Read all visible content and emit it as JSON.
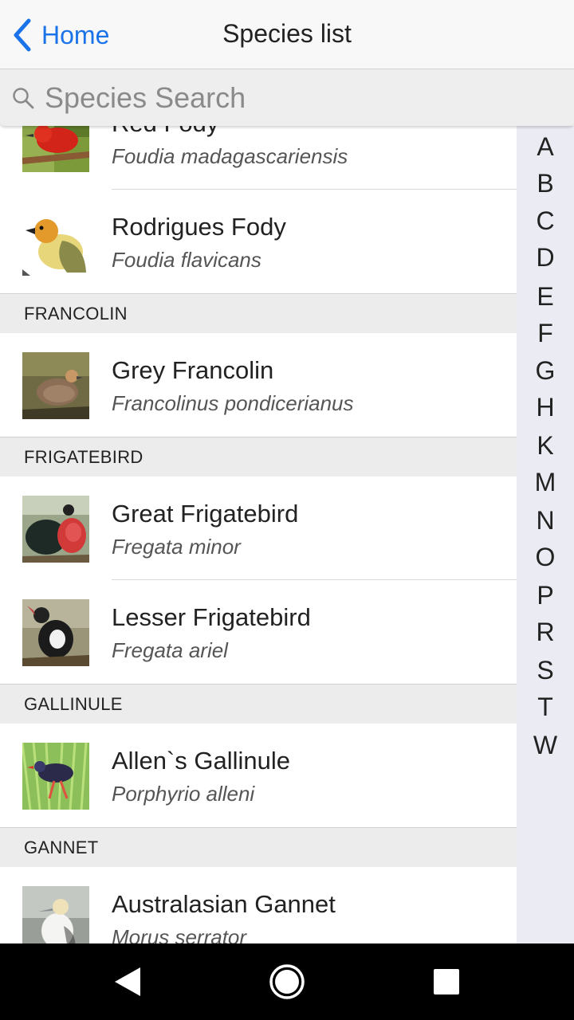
{
  "navbar": {
    "back_label": "Home",
    "title": "Species list"
  },
  "search": {
    "placeholder": "Species Search",
    "value": ""
  },
  "list": {
    "partial_row": {
      "common": "Red Fody",
      "scientific": "Foudia madagascariensis"
    },
    "rows_before": [
      {
        "common": "Rodrigues Fody",
        "scientific": "Foudia flavicans"
      }
    ],
    "sections": [
      {
        "header": "FRANCOLIN",
        "items": [
          {
            "common": "Grey Francolin",
            "scientific": "Francolinus pondicerianus"
          }
        ]
      },
      {
        "header": "FRIGATEBIRD",
        "items": [
          {
            "common": "Great Frigatebird",
            "scientific": "Fregata minor"
          },
          {
            "common": "Lesser Frigatebird",
            "scientific": "Fregata ariel"
          }
        ]
      },
      {
        "header": "GALLINULE",
        "items": [
          {
            "common": "Allen`s Gallinule",
            "scientific": "Porphyrio alleni"
          }
        ]
      },
      {
        "header": "GANNET",
        "items": [
          {
            "common": "Australasian Gannet",
            "scientific": "Morus serrator"
          }
        ]
      }
    ]
  },
  "index_letters": [
    "A",
    "B",
    "C",
    "D",
    "E",
    "F",
    "G",
    "H",
    "K",
    "M",
    "N",
    "O",
    "P",
    "R",
    "S",
    "T",
    "W"
  ],
  "colors": {
    "accent": "#1a73e8",
    "section_bg": "#ececec",
    "index_bg": "#ebebf3",
    "navbar_bg": "#f8f8f8"
  }
}
